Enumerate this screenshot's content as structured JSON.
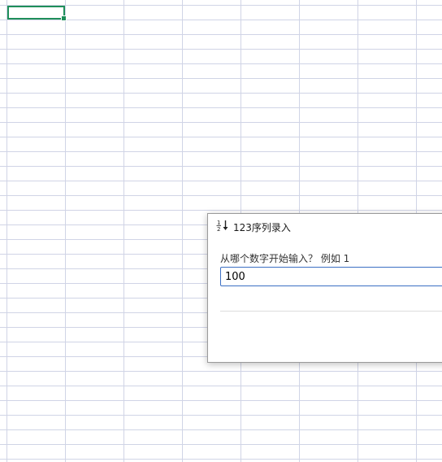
{
  "spreadsheet": {
    "grid_color": "#d0d4e6",
    "active_cell_color": "#1f8f5a"
  },
  "dialog": {
    "title": "123序列录入",
    "icon": "fraction-down-arrow-icon",
    "prompt": "从哪个数字开始输入？ 例如 1",
    "input_value": "100",
    "accent_color": "#3c6fc4"
  }
}
